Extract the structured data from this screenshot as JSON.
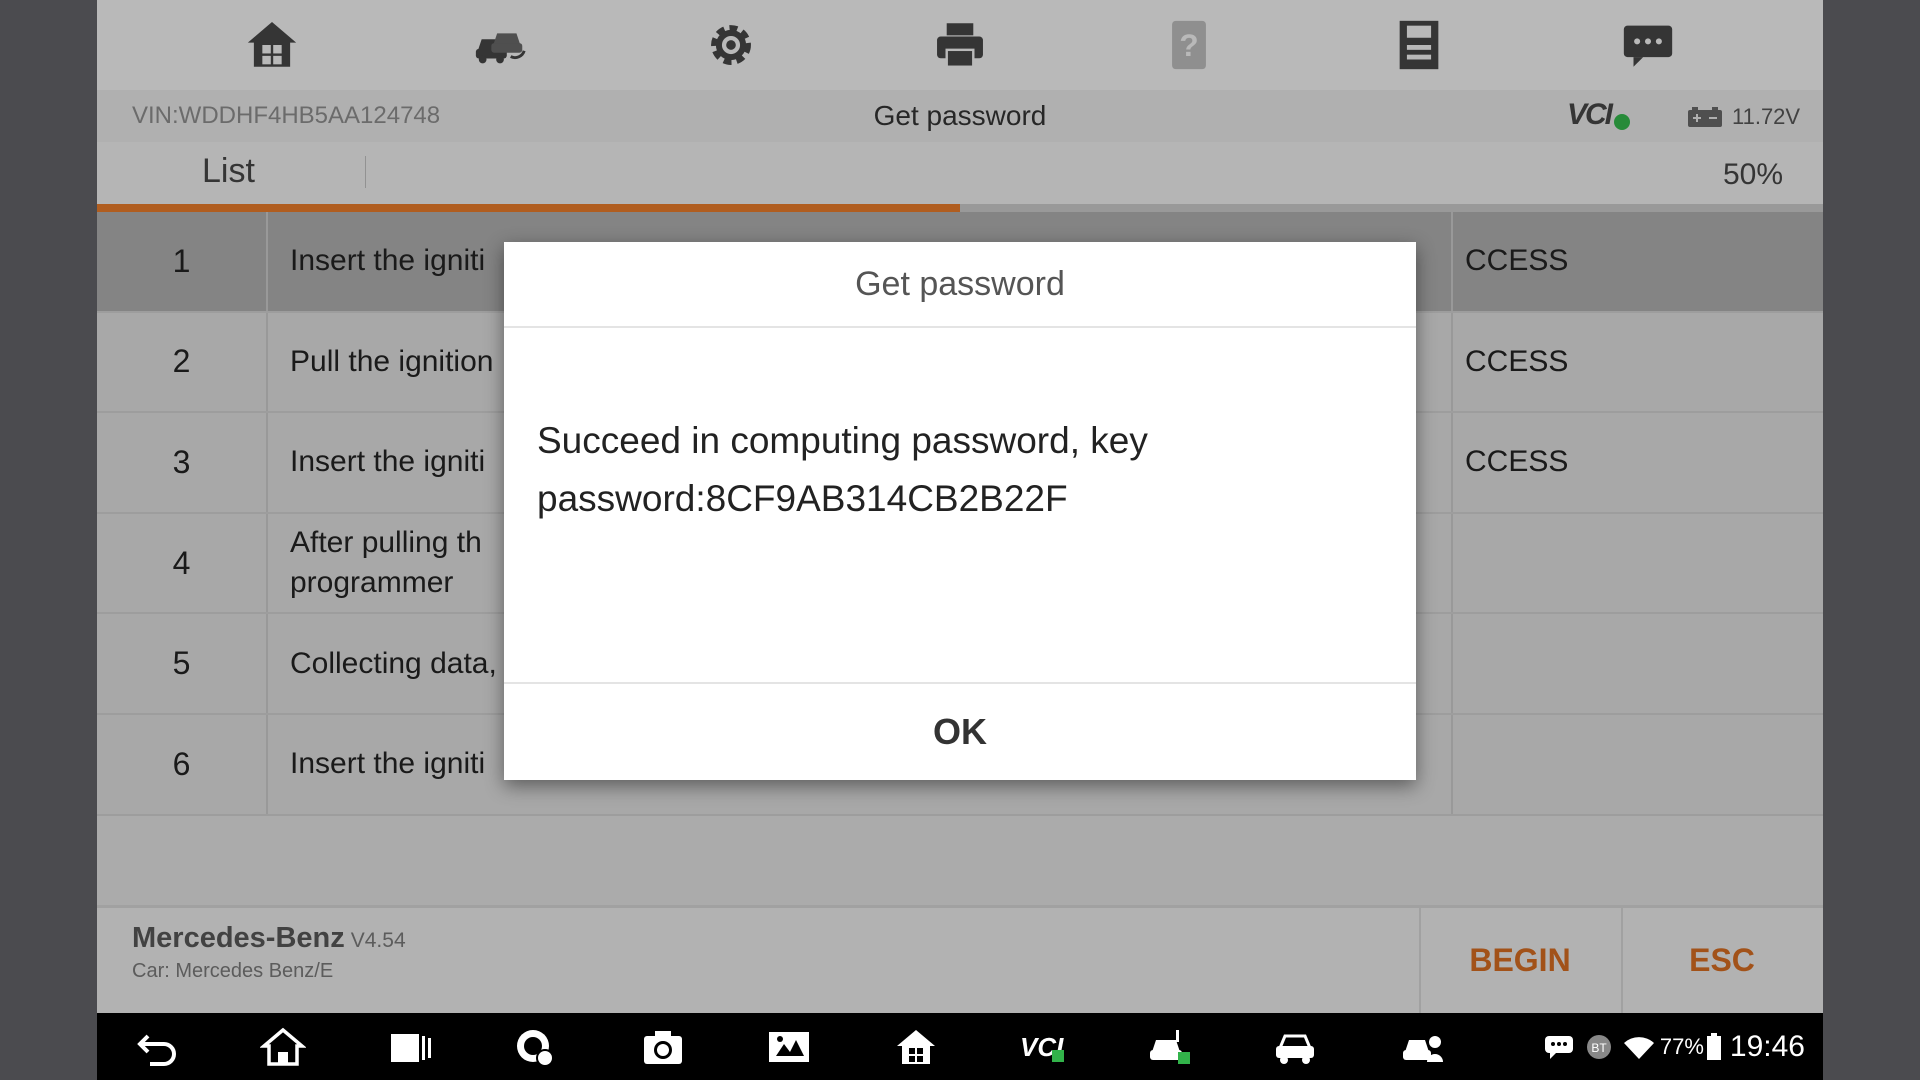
{
  "toolbar": {
    "icons": [
      "home-icon",
      "vehicle-swap-icon",
      "settings-gear-icon",
      "print-icon",
      "help-icon",
      "save-icon",
      "message-icon"
    ]
  },
  "title_bar": {
    "vin": "VIN:WDDHF4HB5AA124748",
    "title": "Get password",
    "vci_label": "VCI",
    "voltage": "11.72V"
  },
  "list_header": {
    "label": "List",
    "progress_text": "50%",
    "progress": 0.5
  },
  "table": {
    "rows": [
      {
        "num": "1",
        "step": "Insert the igniti",
        "result": "CCESS"
      },
      {
        "num": "2",
        "step": "Pull the ignition",
        "result": "CCESS"
      },
      {
        "num": "3",
        "step": "Insert the igniti",
        "result": "CCESS"
      },
      {
        "num": "4",
        "step": "After pulling th\nprogrammer",
        "result": ""
      },
      {
        "num": "5",
        "step": "Collecting data,",
        "result": ""
      },
      {
        "num": "6",
        "step": "Insert the igniti",
        "result": ""
      }
    ]
  },
  "footer": {
    "brand": "Mercedes-Benz",
    "version": "V4.54",
    "car": "Car: Mercedes Benz/E",
    "begin_label": "BEGIN",
    "esc_label": "ESC"
  },
  "dialog": {
    "title": "Get password",
    "message_line1": "Succeed in computing password, key",
    "message_line2": "password:8CF9AB314CB2B22F",
    "ok_label": "OK"
  },
  "navbar": {
    "icons": [
      "back-icon",
      "home-icon",
      "recent-apps-icon",
      "browser-icon",
      "camera-icon",
      "screenshot-icon",
      "app-home-icon",
      "vci-icon",
      "vehicle-connect-icon",
      "car-icon",
      "support-icon"
    ],
    "battery_percent": "77%",
    "time": "19:46"
  },
  "colors": {
    "accent": "#e27828",
    "footer_button": "#d06a20",
    "vci_check": "#32b34a"
  }
}
